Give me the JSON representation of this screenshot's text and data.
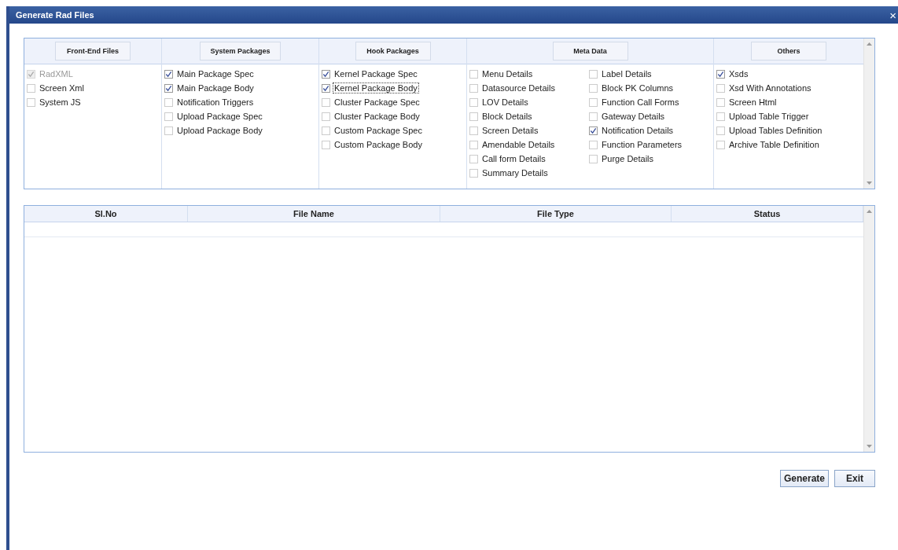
{
  "window": {
    "title": "Generate Rad Files",
    "close": "×"
  },
  "sections": [
    {
      "title": "Front-End Files",
      "columns": [
        [
          {
            "label": "RadXML",
            "checked": true,
            "disabled": true,
            "focused": false
          },
          {
            "label": "Screen Xml",
            "checked": false,
            "disabled": false,
            "focused": false
          },
          {
            "label": "System JS",
            "checked": false,
            "disabled": false,
            "focused": false
          }
        ]
      ]
    },
    {
      "title": "System Packages",
      "columns": [
        [
          {
            "label": "Main Package Spec",
            "checked": true,
            "disabled": false,
            "focused": false
          },
          {
            "label": "Main Package Body",
            "checked": true,
            "disabled": false,
            "focused": false
          },
          {
            "label": "Notification Triggers",
            "checked": false,
            "disabled": false,
            "focused": false
          },
          {
            "label": "Upload Package Spec",
            "checked": false,
            "disabled": false,
            "focused": false
          },
          {
            "label": "Upload Package Body",
            "checked": false,
            "disabled": false,
            "focused": false
          }
        ]
      ]
    },
    {
      "title": "Hook Packages",
      "columns": [
        [
          {
            "label": "Kernel Package Spec",
            "checked": true,
            "disabled": false,
            "focused": false
          },
          {
            "label": "Kernel Package Body",
            "checked": true,
            "disabled": false,
            "focused": true
          },
          {
            "label": "Cluster Package Spec",
            "checked": false,
            "disabled": false,
            "focused": false
          },
          {
            "label": "Cluster Package Body",
            "checked": false,
            "disabled": false,
            "focused": false
          },
          {
            "label": "Custom Package Spec",
            "checked": false,
            "disabled": false,
            "focused": false
          },
          {
            "label": "Custom Package Body",
            "checked": false,
            "disabled": false,
            "focused": false
          }
        ]
      ]
    },
    {
      "title": "Meta Data",
      "columns": [
        [
          {
            "label": "Menu Details",
            "checked": false,
            "disabled": false,
            "focused": false
          },
          {
            "label": "Datasource Details",
            "checked": false,
            "disabled": false,
            "focused": false
          },
          {
            "label": "LOV Details",
            "checked": false,
            "disabled": false,
            "focused": false
          },
          {
            "label": "Block Details",
            "checked": false,
            "disabled": false,
            "focused": false
          },
          {
            "label": "Screen Details",
            "checked": false,
            "disabled": false,
            "focused": false
          },
          {
            "label": "Amendable Details",
            "checked": false,
            "disabled": false,
            "focused": false
          },
          {
            "label": "Call form Details",
            "checked": false,
            "disabled": false,
            "focused": false
          },
          {
            "label": "Summary Details",
            "checked": false,
            "disabled": false,
            "focused": false
          }
        ],
        [
          {
            "label": "Label Details",
            "checked": false,
            "disabled": false,
            "focused": false
          },
          {
            "label": "Block PK Columns",
            "checked": false,
            "disabled": false,
            "focused": false
          },
          {
            "label": "Function Call Forms",
            "checked": false,
            "disabled": false,
            "focused": false
          },
          {
            "label": "Gateway Details",
            "checked": false,
            "disabled": false,
            "focused": false
          },
          {
            "label": "Notification Details",
            "checked": true,
            "disabled": false,
            "focused": false
          },
          {
            "label": "Function Parameters",
            "checked": false,
            "disabled": false,
            "focused": false
          },
          {
            "label": "Purge Details",
            "checked": false,
            "disabled": false,
            "focused": false
          }
        ]
      ]
    },
    {
      "title": "Others",
      "columns": [
        [
          {
            "label": "Xsds",
            "checked": true,
            "disabled": false,
            "focused": false
          },
          {
            "label": "Xsd With Annotations",
            "checked": false,
            "disabled": false,
            "focused": false
          },
          {
            "label": "Screen Html",
            "checked": false,
            "disabled": false,
            "focused": false
          },
          {
            "label": "Upload Table Trigger",
            "checked": false,
            "disabled": false,
            "focused": false
          },
          {
            "label": "Upload Tables Definition",
            "checked": false,
            "disabled": false,
            "focused": false
          },
          {
            "label": "Archive Table Definition",
            "checked": false,
            "disabled": false,
            "focused": false
          }
        ]
      ]
    }
  ],
  "table": {
    "columns": [
      "Sl.No",
      "File Name",
      "File Type",
      "Status"
    ]
  },
  "buttons": [
    "Generate",
    "Exit"
  ]
}
